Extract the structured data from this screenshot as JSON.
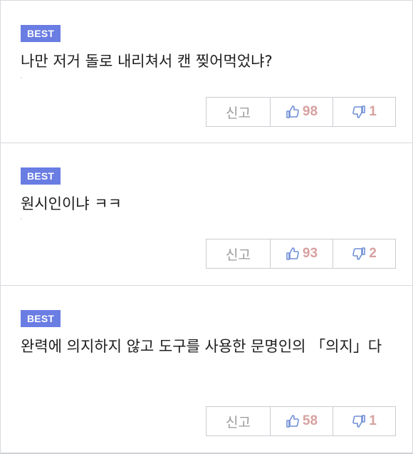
{
  "comments": [
    {
      "badge": "BEST",
      "text": "나만 저거 돌로 내리쳐서 캔 찢어먹었냐?",
      "report_label": "신고",
      "upvotes": "98",
      "downvotes": "1"
    },
    {
      "badge": "BEST",
      "text": "원시인이냐 ㅋㅋ",
      "report_label": "신고",
      "upvotes": "93",
      "downvotes": "2"
    },
    {
      "badge": "BEST",
      "text": "완력에 의지하지 않고 도구를 사용한 문명인의 「의지」다",
      "report_label": "신고",
      "upvotes": "58",
      "downvotes": "1"
    }
  ],
  "icons": {
    "upvote": "thumbs-up-icon",
    "downvote": "thumbs-down-icon"
  },
  "colors": {
    "badge_bg": "#6a7de3",
    "vote_count": "#d8a0a0",
    "thumb_icon": "#6f8ed6"
  }
}
